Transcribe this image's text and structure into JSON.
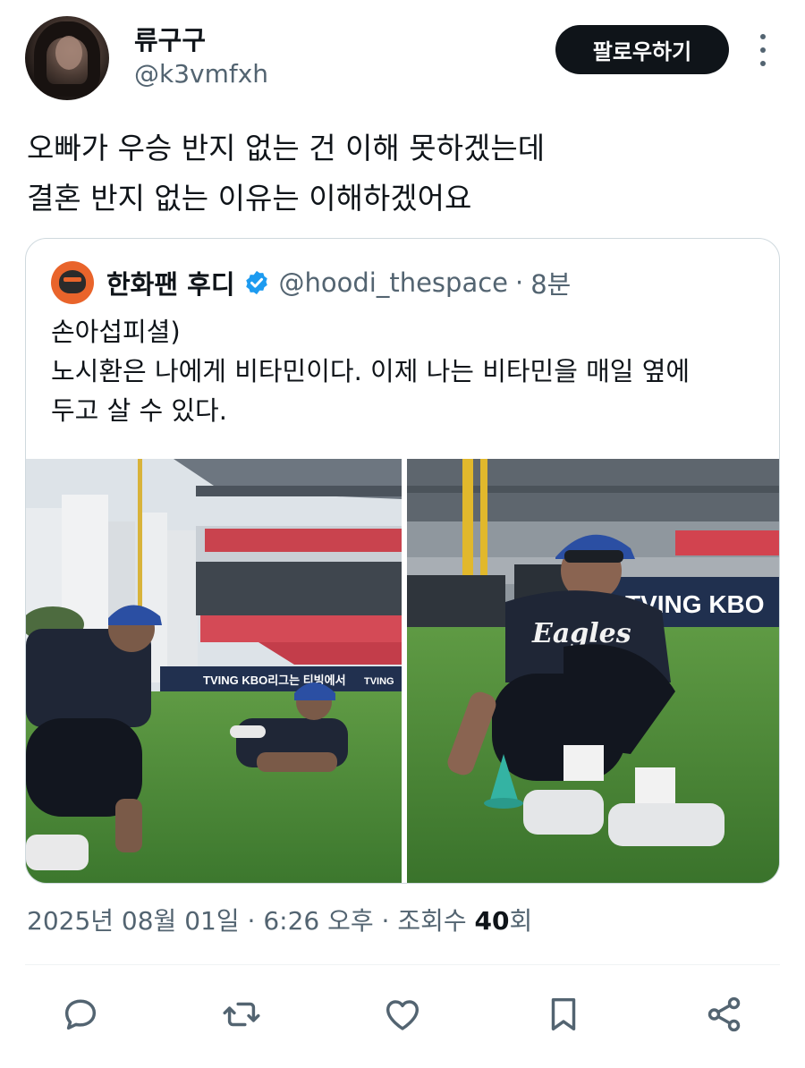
{
  "author": {
    "display_name": "류구구",
    "handle": "@k3vmfxh",
    "follow_label": "팔로우하기"
  },
  "tweet": {
    "lines": [
      "오빠가 우승 반지 없는 건 이해 못하겠는데",
      "결혼 반지 없는 이유는 이해하겠어요"
    ]
  },
  "quoted": {
    "display_name": "한화팬 후디",
    "handle": "@hoodi_thespace",
    "separator": "·",
    "time": "8분",
    "lines": [
      "손아섭피셜)",
      "노시환은 나에게 비타민이다. 이제 나는 비타민을 매일 옆에",
      "두고 살 수 있다."
    ],
    "photos": {
      "left": {
        "board_text": "TVING  KBO리그는 티빙에서",
        "board_text_right": "TVING"
      },
      "right": {
        "board_text": "TVING  KBO",
        "jersey_text": "Eagles"
      }
    }
  },
  "meta": {
    "date": "2025년 08월 01일",
    "dot1": "·",
    "time": "6:26 오후",
    "dot2": "·",
    "views_label": "조회수",
    "views_count": "40",
    "views_unit": "회"
  },
  "actions": {
    "icons": [
      "reply-icon",
      "retweet-icon",
      "like-icon",
      "bookmark-icon",
      "share-icon"
    ]
  },
  "colors": {
    "text": "#0f1419",
    "secondary": "#536471",
    "verified": "#1d9bf0",
    "follow_bg": "#0f1419",
    "border": "#cfd9de"
  }
}
